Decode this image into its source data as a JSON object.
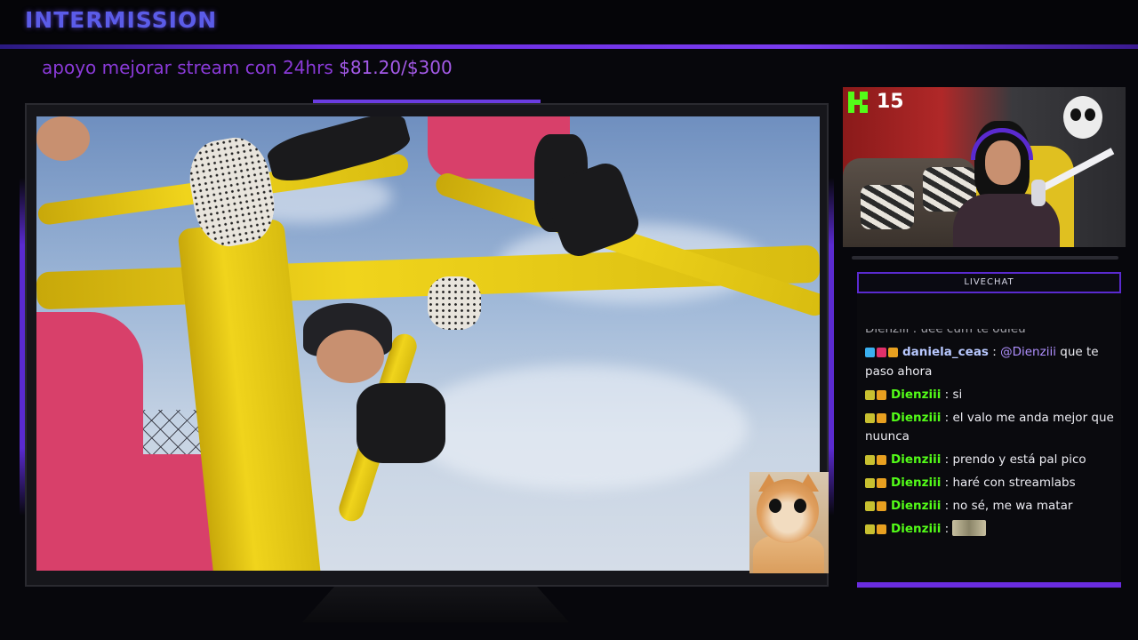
{
  "header": {
    "title": "INTERMISSION",
    "goal_text": "apoyo mejorar stream con 24hrs",
    "goal_amount": "$81.20/$300"
  },
  "webcam": {
    "platform_icon": "kick-logo-icon",
    "viewer_count": "15"
  },
  "chat": {
    "header": "LIVECHAT",
    "partial_line": "Dienziii : uee cum te ouleu",
    "messages": [
      {
        "badges": [
          "bot-icon",
          "heart-badge-icon",
          "crown-badge-icon"
        ],
        "user": "daniela_ceas",
        "user_color": "#b8c8ff",
        "mention": "@Dienziii",
        "text": "que te paso ahora"
      },
      {
        "badges": [
          "cat-badge-icon",
          "crown-badge-icon"
        ],
        "user": "Dienziii",
        "user_color": "#53fc18",
        "mention": "",
        "text": "si"
      },
      {
        "badges": [
          "cat-badge-icon",
          "crown-badge-icon"
        ],
        "user": "Dienziii",
        "user_color": "#53fc18",
        "mention": "",
        "text": "el valo me anda mejor que nuunca"
      },
      {
        "badges": [
          "cat-badge-icon",
          "crown-badge-icon"
        ],
        "user": "Dienziii",
        "user_color": "#53fc18",
        "mention": "",
        "text": "prendo y está pal pico"
      },
      {
        "badges": [
          "cat-badge-icon",
          "crown-badge-icon"
        ],
        "user": "Dienziii",
        "user_color": "#53fc18",
        "mention": "",
        "text": "haré con streamlabs"
      },
      {
        "badges": [
          "cat-badge-icon",
          "crown-badge-icon"
        ],
        "user": "Dienziii",
        "user_color": "#53fc18",
        "mention": "",
        "text": "no sé, me wa matar"
      },
      {
        "badges": [
          "cat-badge-icon",
          "crown-badge-icon"
        ],
        "user": "Dienziii",
        "user_color": "#53fc18",
        "mention": "",
        "text": "",
        "emote": "emote-image"
      }
    ]
  },
  "colors": {
    "accent": "#6a2ce0",
    "title": "#5b5ce8",
    "goal": "#8a3ad8",
    "kick_green": "#53fc18"
  }
}
